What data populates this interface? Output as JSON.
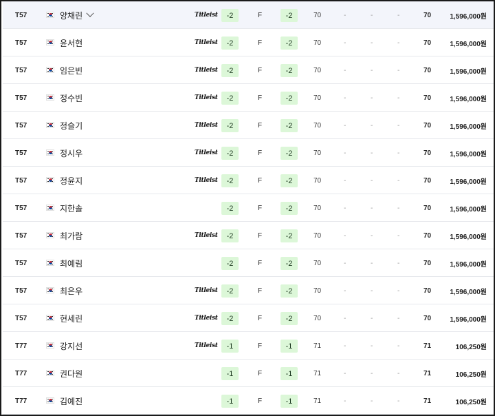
{
  "rows": [
    {
      "rank": "T57",
      "name": "양채린",
      "sponsor": "Titleist",
      "score": "-2",
      "thru": "F",
      "total": "-2",
      "r1": "70",
      "r2": "-",
      "r3": "-",
      "r4": "-",
      "strokes": "70",
      "prize": "1,596,000원",
      "expanded": true
    },
    {
      "rank": "T57",
      "name": "윤서현",
      "sponsor": "Titleist",
      "score": "-2",
      "thru": "F",
      "total": "-2",
      "r1": "70",
      "r2": "-",
      "r3": "-",
      "r4": "-",
      "strokes": "70",
      "prize": "1,596,000원"
    },
    {
      "rank": "T57",
      "name": "임은빈",
      "sponsor": "Titleist",
      "score": "-2",
      "thru": "F",
      "total": "-2",
      "r1": "70",
      "r2": "-",
      "r3": "-",
      "r4": "-",
      "strokes": "70",
      "prize": "1,596,000원"
    },
    {
      "rank": "T57",
      "name": "정수빈",
      "sponsor": "Titleist",
      "score": "-2",
      "thru": "F",
      "total": "-2",
      "r1": "70",
      "r2": "-",
      "r3": "-",
      "r4": "-",
      "strokes": "70",
      "prize": "1,596,000원"
    },
    {
      "rank": "T57",
      "name": "정슬기",
      "sponsor": "Titleist",
      "score": "-2",
      "thru": "F",
      "total": "-2",
      "r1": "70",
      "r2": "-",
      "r3": "-",
      "r4": "-",
      "strokes": "70",
      "prize": "1,596,000원"
    },
    {
      "rank": "T57",
      "name": "정시우",
      "sponsor": "Titleist",
      "score": "-2",
      "thru": "F",
      "total": "-2",
      "r1": "70",
      "r2": "-",
      "r3": "-",
      "r4": "-",
      "strokes": "70",
      "prize": "1,596,000원"
    },
    {
      "rank": "T57",
      "name": "정윤지",
      "sponsor": "Titleist",
      "score": "-2",
      "thru": "F",
      "total": "-2",
      "r1": "70",
      "r2": "-",
      "r3": "-",
      "r4": "-",
      "strokes": "70",
      "prize": "1,596,000원"
    },
    {
      "rank": "T57",
      "name": "지한솔",
      "sponsor": "",
      "score": "-2",
      "thru": "F",
      "total": "-2",
      "r1": "70",
      "r2": "-",
      "r3": "-",
      "r4": "-",
      "strokes": "70",
      "prize": "1,596,000원"
    },
    {
      "rank": "T57",
      "name": "최가람",
      "sponsor": "Titleist",
      "score": "-2",
      "thru": "F",
      "total": "-2",
      "r1": "70",
      "r2": "-",
      "r3": "-",
      "r4": "-",
      "strokes": "70",
      "prize": "1,596,000원"
    },
    {
      "rank": "T57",
      "name": "최예림",
      "sponsor": "",
      "score": "-2",
      "thru": "F",
      "total": "-2",
      "r1": "70",
      "r2": "-",
      "r3": "-",
      "r4": "-",
      "strokes": "70",
      "prize": "1,596,000원"
    },
    {
      "rank": "T57",
      "name": "최은우",
      "sponsor": "Titleist",
      "score": "-2",
      "thru": "F",
      "total": "-2",
      "r1": "70",
      "r2": "-",
      "r3": "-",
      "r4": "-",
      "strokes": "70",
      "prize": "1,596,000원"
    },
    {
      "rank": "T57",
      "name": "현세린",
      "sponsor": "Titleist",
      "score": "-2",
      "thru": "F",
      "total": "-2",
      "r1": "70",
      "r2": "-",
      "r3": "-",
      "r4": "-",
      "strokes": "70",
      "prize": "1,596,000원"
    },
    {
      "rank": "T77",
      "name": "강지선",
      "sponsor": "Titleist",
      "score": "-1",
      "thru": "F",
      "total": "-1",
      "r1": "71",
      "r2": "-",
      "r3": "-",
      "r4": "-",
      "strokes": "71",
      "prize": "106,250원"
    },
    {
      "rank": "T77",
      "name": "권다원",
      "sponsor": "",
      "score": "-1",
      "thru": "F",
      "total": "-1",
      "r1": "71",
      "r2": "-",
      "r3": "-",
      "r4": "-",
      "strokes": "71",
      "prize": "106,250원"
    },
    {
      "rank": "T77",
      "name": "김예진",
      "sponsor": "",
      "score": "-1",
      "thru": "F",
      "total": "-1",
      "r1": "71",
      "r2": "-",
      "r3": "-",
      "r4": "-",
      "strokes": "71",
      "prize": "106,250원"
    }
  ],
  "icons": {
    "flag": "south-korea-flag-icon",
    "expand": "chevron-down-icon",
    "sponsor": "titleist-logo"
  },
  "colors": {
    "score_pill": "#dcf7d8",
    "highlight_row": "#f3f5fb",
    "divider": "#e6e8ec"
  }
}
